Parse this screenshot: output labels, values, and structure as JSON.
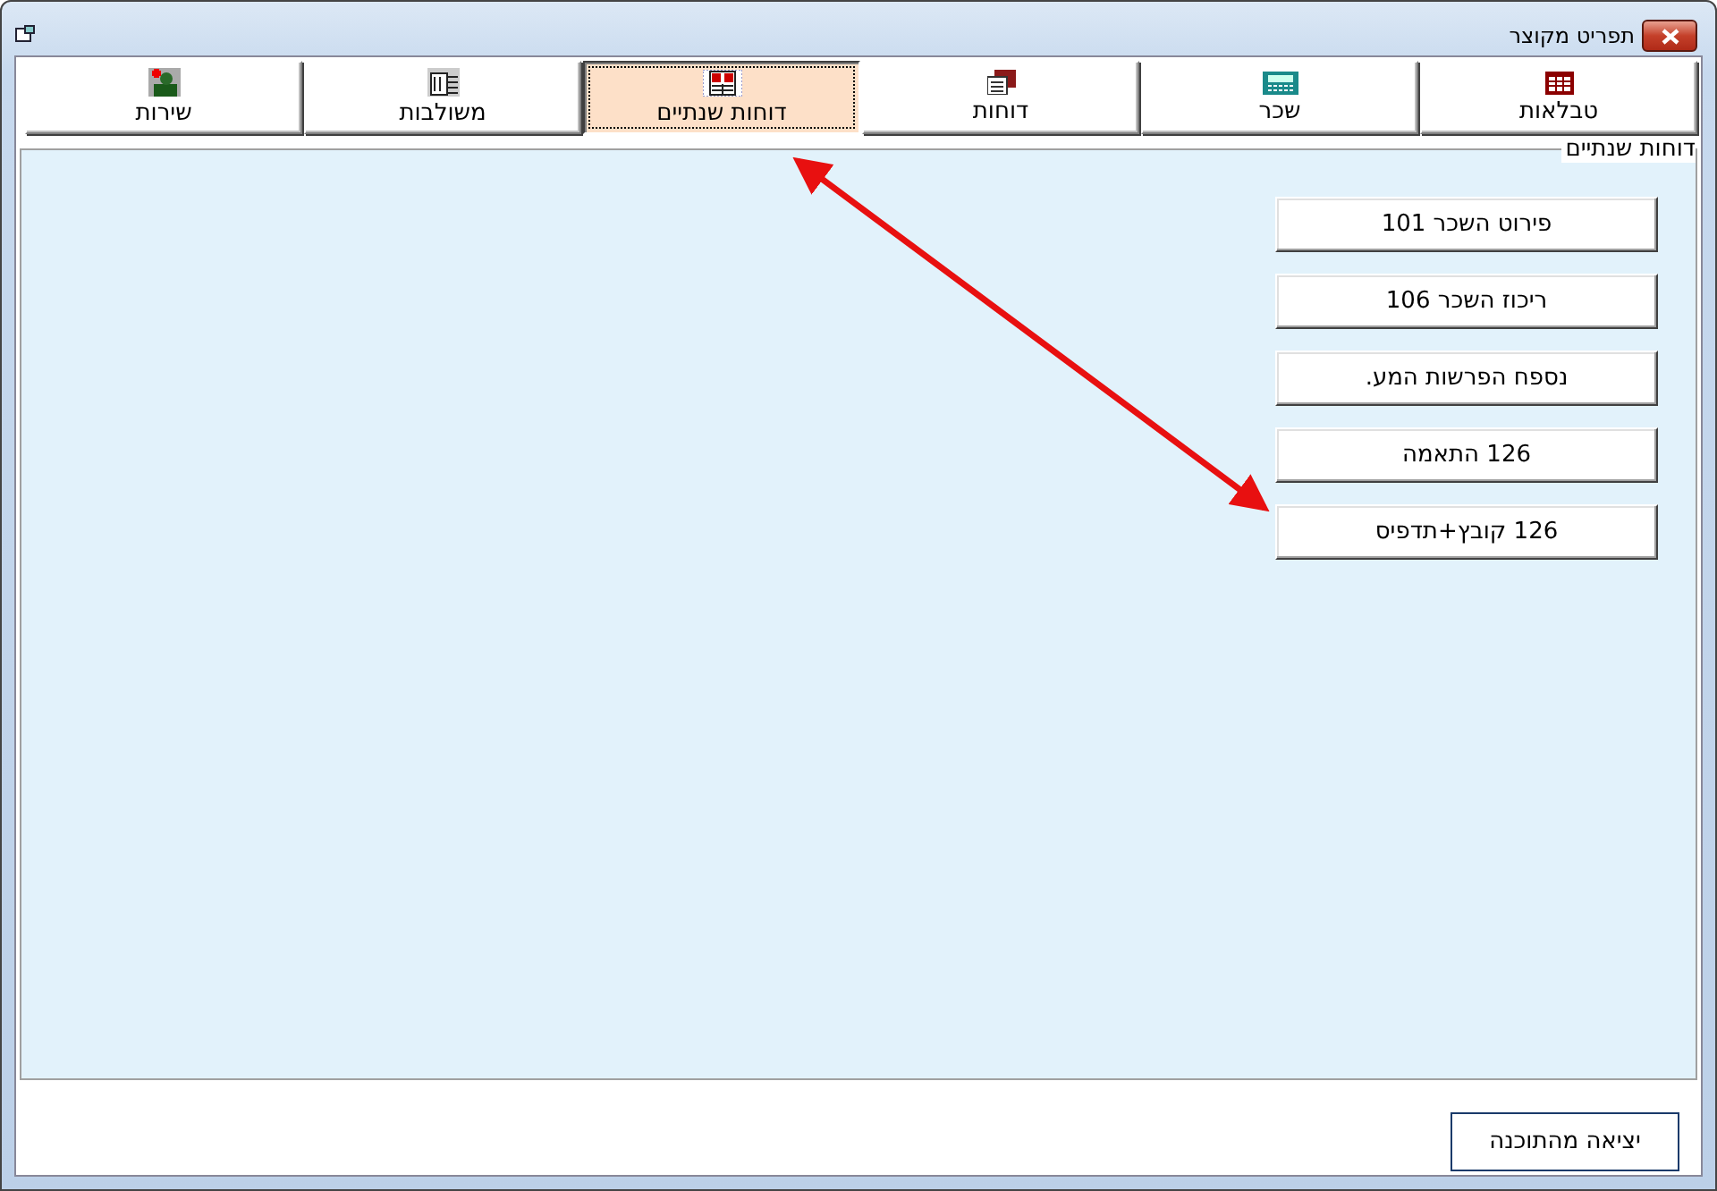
{
  "window": {
    "title": "תפריט מקוצר"
  },
  "tabs": [
    {
      "label": "טבלאות",
      "kind": "table",
      "selected": false
    },
    {
      "label": "שכר",
      "kind": "calculator",
      "selected": false
    },
    {
      "label": "דוחות",
      "kind": "reports",
      "selected": false
    },
    {
      "label": "דוחות שנתיים",
      "kind": "calendar",
      "selected": true
    },
    {
      "label": "משולבות",
      "kind": "binder",
      "selected": false
    },
    {
      "label": "שירות",
      "kind": "service",
      "selected": false
    }
  ],
  "group": {
    "title": "דוחות שנתיים",
    "buttons": [
      "פירוט השכר 101",
      "ריכוז השכר 106",
      "נספח הפרשות המע.",
      "126 התאמה",
      "126 קובץ+תדפיס"
    ]
  },
  "exit_button": "יציאה מהתוכנה"
}
